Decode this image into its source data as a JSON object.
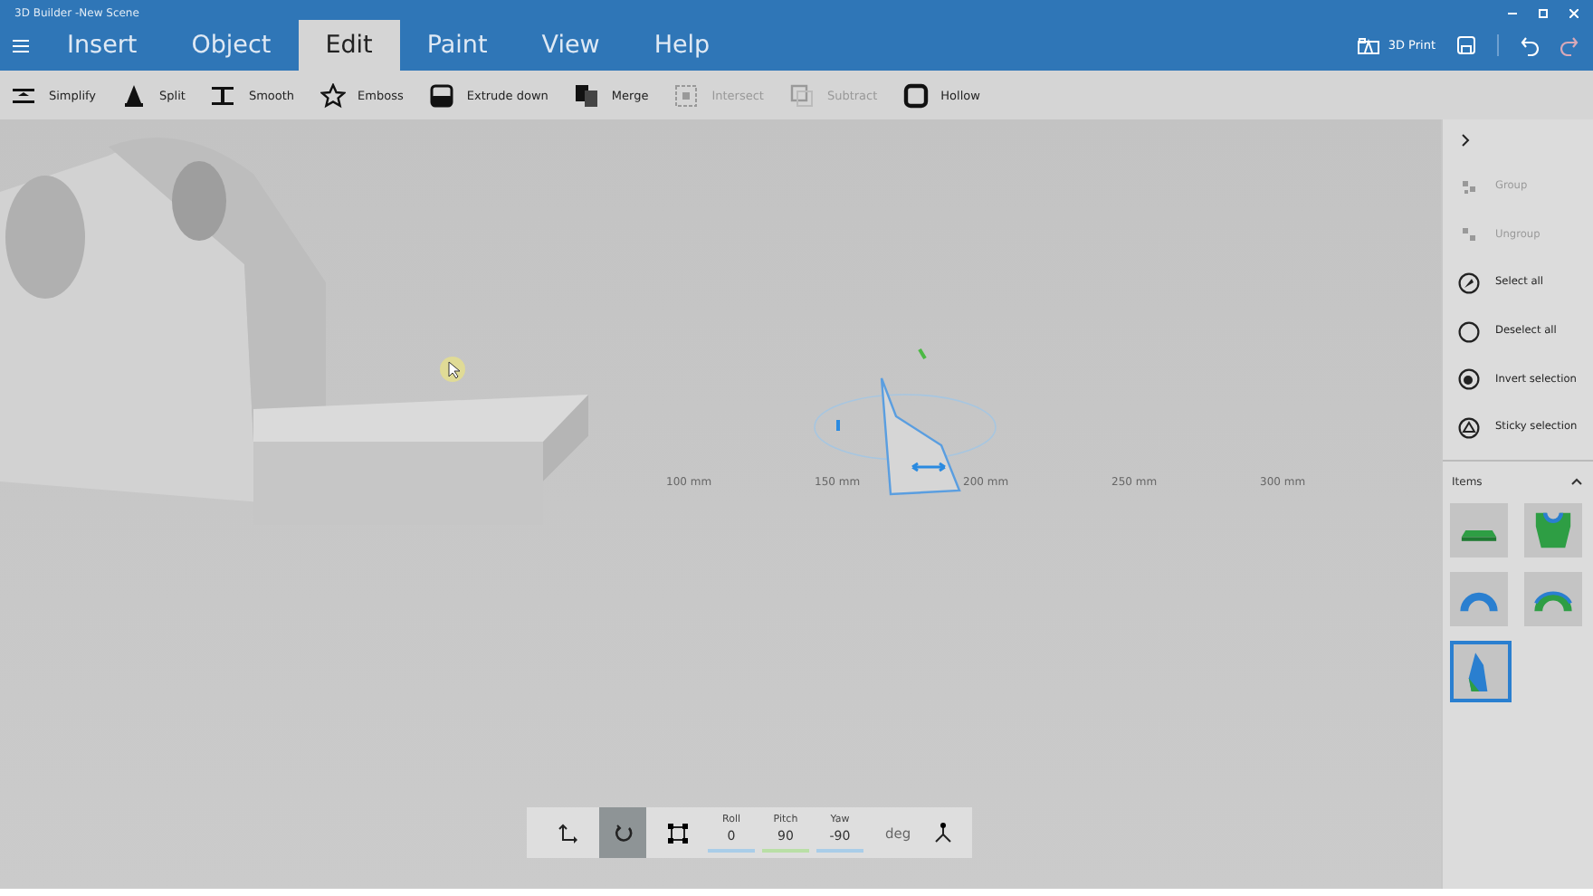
{
  "window": {
    "title": "3D Builder -New Scene"
  },
  "tabs": [
    {
      "label": "Insert",
      "selected": false
    },
    {
      "label": "Object",
      "selected": false
    },
    {
      "label": "Edit",
      "selected": true
    },
    {
      "label": "Paint",
      "selected": false
    },
    {
      "label": "View",
      "selected": false
    },
    {
      "label": "Help",
      "selected": false
    }
  ],
  "actions": {
    "print": "3D Print"
  },
  "toolbar": [
    {
      "label": "Simplify",
      "disabled": false
    },
    {
      "label": "Split",
      "disabled": false
    },
    {
      "label": "Smooth",
      "disabled": false
    },
    {
      "label": "Emboss",
      "disabled": false
    },
    {
      "label": "Extrude down",
      "disabled": false
    },
    {
      "label": "Merge",
      "disabled": false
    },
    {
      "label": "Intersect",
      "disabled": true
    },
    {
      "label": "Subtract",
      "disabled": true
    },
    {
      "label": "Hollow",
      "disabled": false
    }
  ],
  "viewport": {
    "ruler_labels": [
      "100 mm",
      "150 mm",
      "200 mm",
      "250 mm",
      "300 mm"
    ]
  },
  "sidebar": {
    "items": [
      {
        "label": "Group",
        "disabled": true
      },
      {
        "label": "Ungroup",
        "disabled": true
      },
      {
        "label": "Select all",
        "disabled": false
      },
      {
        "label": "Deselect all",
        "disabled": false
      },
      {
        "label": "Invert selection",
        "disabled": false
      },
      {
        "label": "Sticky selection",
        "disabled": false
      }
    ],
    "items_title": "Items",
    "thumbnails": [
      {
        "selected": false
      },
      {
        "selected": false
      },
      {
        "selected": false
      },
      {
        "selected": false
      },
      {
        "selected": true
      }
    ]
  },
  "transform_bar": {
    "modes": [
      {
        "selected": false
      },
      {
        "selected": true
      },
      {
        "selected": false
      }
    ],
    "fields": [
      {
        "label": "Roll",
        "value": "0",
        "color": "#a9cde8"
      },
      {
        "label": "Pitch",
        "value": "90",
        "color": "#b9dfa6"
      },
      {
        "label": "Yaw",
        "value": "-90",
        "color": "#a9cde8"
      }
    ],
    "unit": "deg"
  }
}
